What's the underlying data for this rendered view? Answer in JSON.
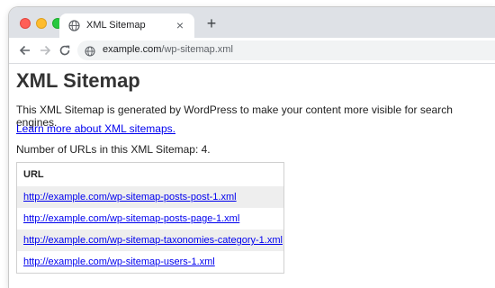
{
  "browser": {
    "tab_title": "XML Sitemap",
    "tab_close": "×",
    "new_tab": "+",
    "url_host": "example.com",
    "url_path": "/wp-sitemap.xml"
  },
  "page": {
    "heading": "XML Sitemap",
    "description": "This XML Sitemap is generated by WordPress to make your content more visible for search engines.",
    "learn_more_link": "Learn more about XML sitemaps.",
    "url_count_text": "Number of URLs in this XML Sitemap: 4.",
    "table_header": "URL",
    "urls": [
      "http://example.com/wp-sitemap-posts-post-1.xml",
      "http://example.com/wp-sitemap-posts-page-1.xml",
      "http://example.com/wp-sitemap-taxonomies-category-1.xml",
      "http://example.com/wp-sitemap-users-1.xml"
    ]
  },
  "colors": {
    "link": "#0000ee",
    "row_alt": "#eeeeee",
    "tabstrip": "#dee1e6"
  }
}
